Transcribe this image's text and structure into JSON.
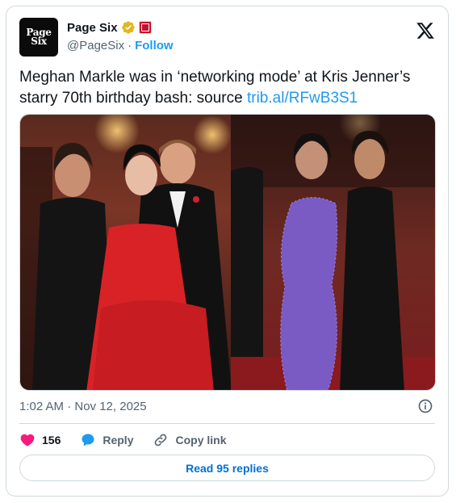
{
  "account": {
    "name": "Page Six",
    "handle": "@PageSix",
    "separator": "·",
    "follow_label": "Follow",
    "avatar_line1": "Page",
    "avatar_line2": "Six",
    "verified_icon": "gold-check-badge-icon",
    "affiliate_icon": "red-affiliate-badge-icon"
  },
  "tweet": {
    "text": "Meghan Markle was in ‘networking mode’ at Kris Jenner’s starry 70th birthday bash: source ",
    "link": "trib.al/RFwB3S1",
    "timestamp": "1:02 AM · Nov 12, 2025"
  },
  "actions": {
    "like_count": "156",
    "reply_label": "Reply",
    "copy_label": "Copy link",
    "read_replies_label": "Read 95 replies"
  },
  "colors": {
    "accent": "#1d9bf0",
    "like": "#f91880",
    "border": "#cfd9de"
  }
}
